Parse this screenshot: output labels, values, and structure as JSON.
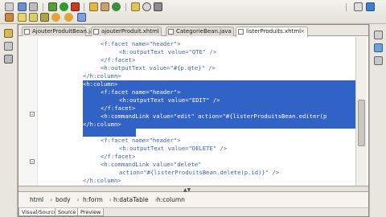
{
  "editor": {
    "tabs": [
      {
        "label": "AjouterProduitBean.java",
        "active": false
      },
      {
        "label": "ajouterProduit.xhtml",
        "active": false
      },
      {
        "label": "CategorieBean.java",
        "active": false
      },
      {
        "label": "listerProduits.xhtml",
        "active": true
      }
    ],
    "tab_close_glyph": "×",
    "lines": [
      "<f:facet name=\"header\">",
      "<h:outputText value=\"QTE\" />",
      "</f:facet>",
      "<h:outputText value=\"#{p.qte}\" />",
      "</h:column>",
      "<h:column>",
      "<f:facet name=\"header\">",
      "<h:outputText value=\"EDIT\" />",
      "</f:facet>",
      "<h:commandLink value=\"edit\" action=\"#{listerProduitsBean.editer(p",
      "</h:column>",
      "<h:column>",
      "<f:facet name=\"header\">",
      "<h:outputText value=\"DELETE\" />",
      "</f:facet>",
      "<h:commandLink value=\"delete\"",
      "action=\"#{listerProduitsBean.delete(p.id)}\" />",
      "</h:column>"
    ],
    "selected_lines": [
      5,
      10
    ]
  },
  "breadcrumb": [
    "html",
    "body",
    "h:form",
    "h:dataTable",
    "h:column"
  ],
  "bottom_tabs": [
    {
      "label": "Visual/Source",
      "active": true
    },
    {
      "label": "Source",
      "active": false
    },
    {
      "label": "Preview",
      "active": false
    }
  ],
  "colors": {
    "selection": "#3162c5",
    "attribute_value": "#2a00ff",
    "background": "#d4d0c8"
  }
}
